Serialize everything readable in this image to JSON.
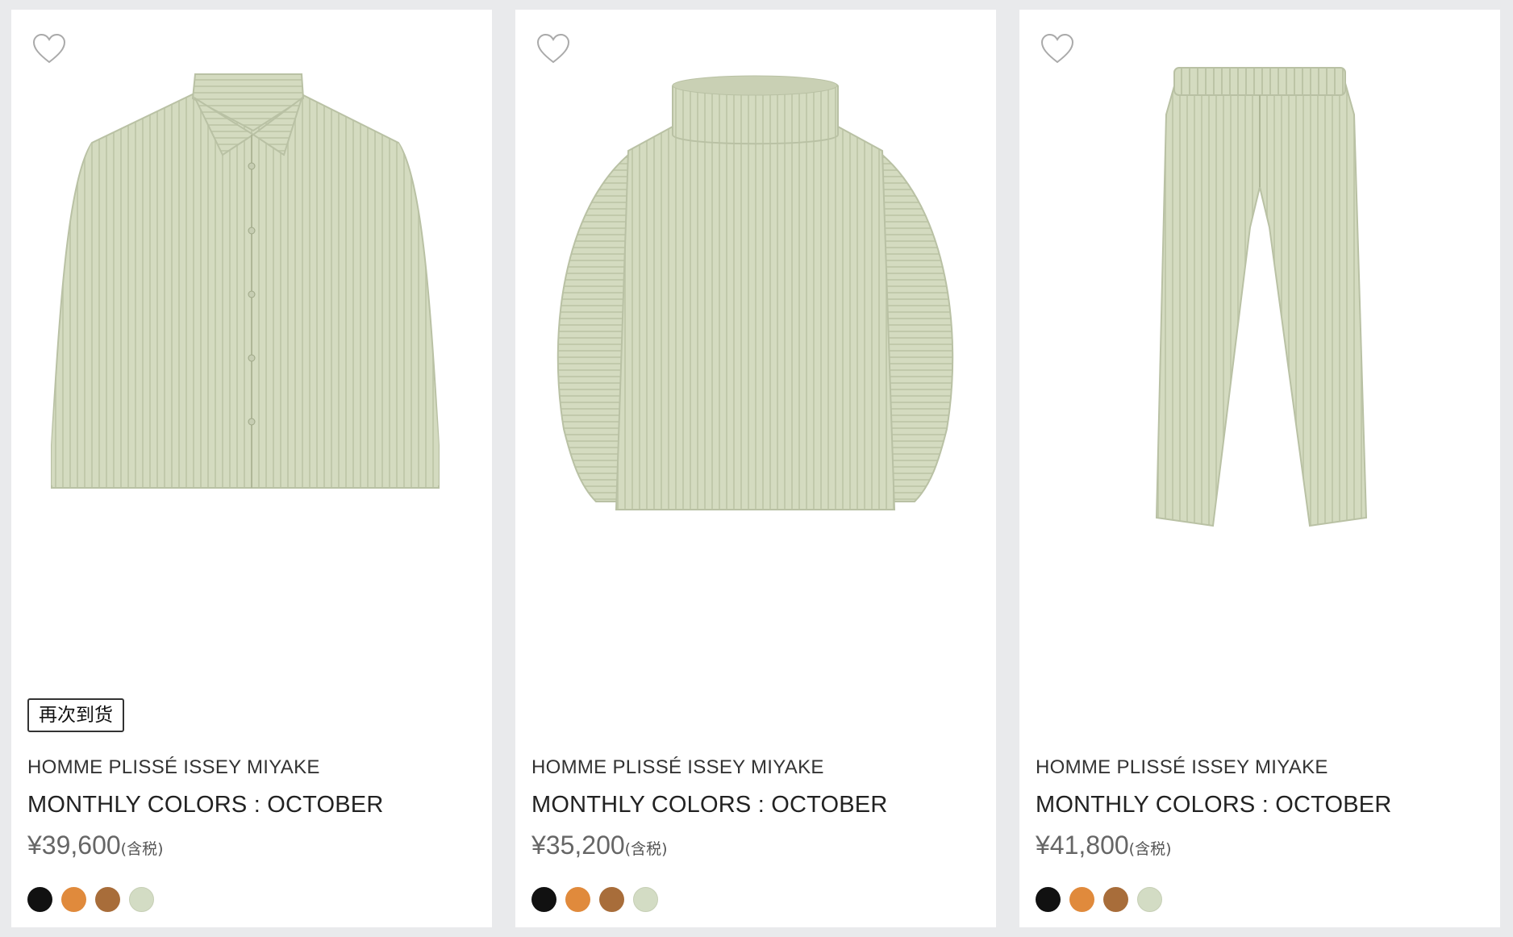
{
  "products": [
    {
      "badge": "再次到货",
      "brand": "HOMME PLISSÉ ISSEY MIYAKE",
      "name": "MONTHLY COLORS : OCTOBER",
      "price": "¥39,600",
      "tax_note": "(含税)",
      "image": "pleated-shirt",
      "swatches": [
        "#111111",
        "#e08a3c",
        "#a86d3a",
        "#d3dcc4"
      ]
    },
    {
      "badge": "",
      "brand": "HOMME PLISSÉ ISSEY MIYAKE",
      "name": "MONTHLY COLORS : OCTOBER",
      "price": "¥35,200",
      "tax_note": "(含税)",
      "image": "pleated-turtleneck",
      "swatches": [
        "#111111",
        "#e08a3c",
        "#a86d3a",
        "#d3dcc4"
      ]
    },
    {
      "badge": "",
      "brand": "HOMME PLISSÉ ISSEY MIYAKE",
      "name": "MONTHLY COLORS : OCTOBER",
      "price": "¥41,800",
      "tax_note": "(含税)",
      "image": "pleated-trousers",
      "swatches": [
        "#111111",
        "#e08a3c",
        "#a86d3a",
        "#d3dcc4"
      ]
    }
  ],
  "garment_color": "#d4dbc0"
}
